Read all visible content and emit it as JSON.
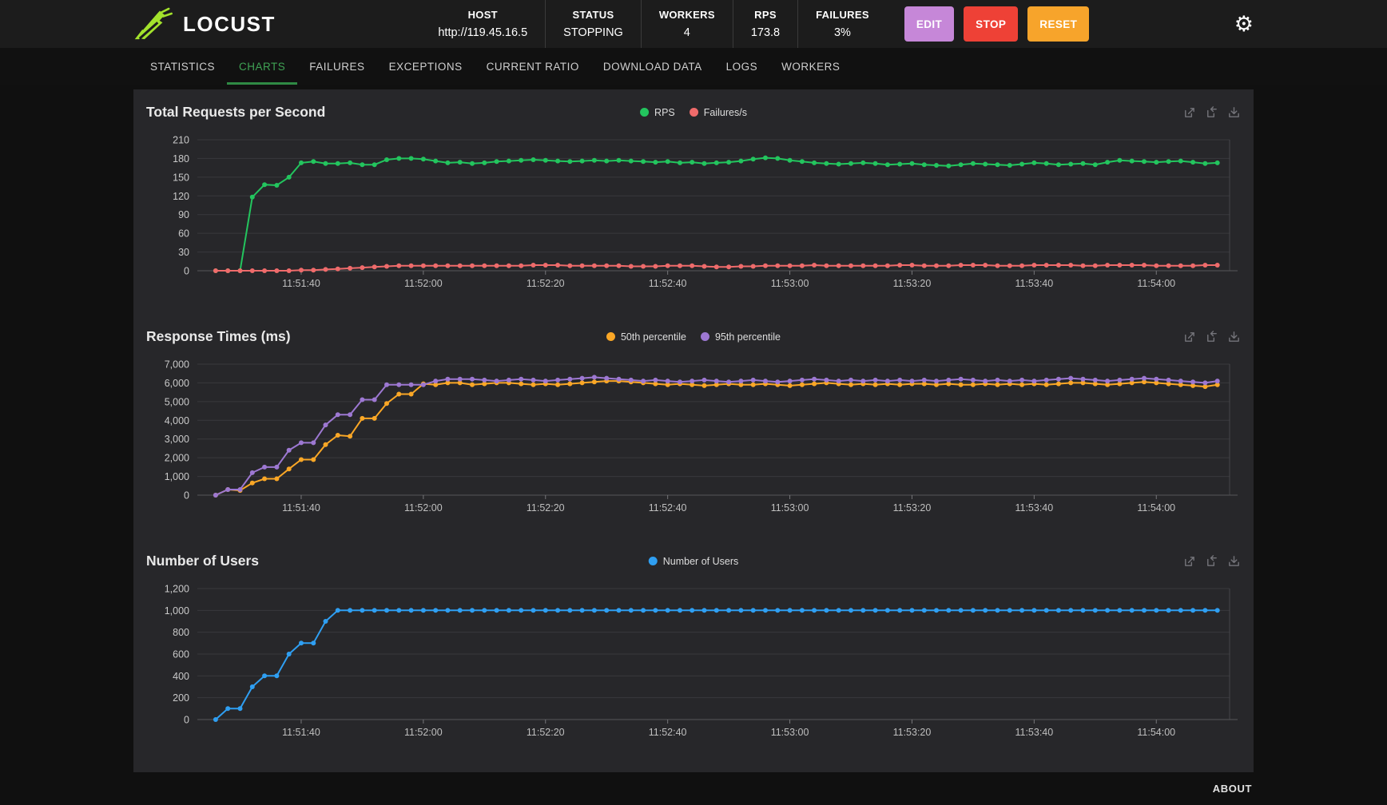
{
  "app": {
    "logo_text": "LOCUST"
  },
  "colors": {
    "logo_green": "#a3e22c",
    "tab_active_green": "#3fa254",
    "rps_green": "#23c55e",
    "failures_red": "#ef6b6b",
    "p50_orange": "#faa726",
    "p95_purple": "#9d78d2",
    "users_blue": "#2f9ff2",
    "edit_purple": "#c687d8",
    "stop_red": "#ee4136",
    "reset_orange": "#f7a42b",
    "panel_bg": "#27272a",
    "header_bg": "#1c1c1c"
  },
  "icons": {
    "settings": "gear-icon",
    "chart_toolbox": [
      "zoom-select-icon",
      "zoom-reset-icon",
      "download-image-icon"
    ]
  },
  "header": {
    "stats": [
      {
        "label": "HOST",
        "value": "http://119.45.16.5"
      },
      {
        "label": "STATUS",
        "value": "STOPPING"
      },
      {
        "label": "WORKERS",
        "value": "4"
      },
      {
        "label": "RPS",
        "value": "173.8"
      },
      {
        "label": "FAILURES",
        "value": "3%"
      }
    ],
    "buttons": {
      "edit": "EDIT",
      "stop": "STOP",
      "reset": "RESET"
    }
  },
  "tabs": {
    "items": [
      {
        "label": "STATISTICS",
        "active": false
      },
      {
        "label": "CHARTS",
        "active": true
      },
      {
        "label": "FAILURES",
        "active": false
      },
      {
        "label": "EXCEPTIONS",
        "active": false
      },
      {
        "label": "CURRENT RATIO",
        "active": false
      },
      {
        "label": "DOWNLOAD DATA",
        "active": false
      },
      {
        "label": "LOGS",
        "active": false
      },
      {
        "label": "WORKERS",
        "active": false
      }
    ]
  },
  "footer": {
    "about": "ABOUT"
  },
  "chart_data": [
    {
      "type": "line",
      "title": "Total Requests per Second",
      "y_max": 210,
      "y_ticks": [
        0,
        30,
        60,
        90,
        120,
        150,
        180,
        210
      ],
      "y_tick_labels": [
        "0",
        "30",
        "60",
        "90",
        "120",
        "150",
        "180",
        "210"
      ],
      "x_axis": {
        "start": "11:51:23",
        "end": "11:54:12",
        "ticks": [
          "11:51:40",
          "11:52:00",
          "11:52:20",
          "11:52:40",
          "11:53:00",
          "11:53:20",
          "11:53:40",
          "11:54:00"
        ]
      },
      "points_start": "11:51:26",
      "points_interval_s": 2,
      "series": [
        {
          "name": "RPS",
          "color": "#23c55e",
          "values": [
            0,
            0,
            0,
            118,
            138,
            137,
            150,
            173,
            175,
            172,
            172,
            173,
            170,
            170,
            178,
            180,
            180,
            179,
            176,
            173,
            174,
            172,
            173,
            175,
            176,
            177,
            178,
            177,
            176,
            175,
            176,
            177,
            176,
            177,
            176,
            175,
            174,
            175,
            173,
            174,
            172,
            173,
            174,
            176,
            179,
            181,
            180,
            177,
            175,
            173,
            172,
            171,
            172,
            173,
            172,
            170,
            171,
            172,
            170,
            169,
            168,
            170,
            172,
            171,
            170,
            169,
            171,
            173,
            172,
            170,
            171,
            172,
            170,
            174,
            177,
            176,
            175,
            174,
            175,
            176,
            174,
            172,
            173
          ]
        },
        {
          "name": "Failures/s",
          "color": "#ef6b6b",
          "values": [
            0,
            0,
            0,
            0,
            0,
            0,
            0,
            1,
            1,
            2,
            3,
            4,
            5,
            6,
            7,
            8,
            8,
            8,
            8,
            8,
            8,
            8,
            8,
            8,
            8,
            8,
            9,
            9,
            9,
            8,
            8,
            8,
            8,
            8,
            7,
            7,
            7,
            8,
            8,
            8,
            7,
            6,
            6,
            7,
            7,
            8,
            8,
            8,
            8,
            9,
            8,
            8,
            8,
            8,
            8,
            8,
            9,
            9,
            8,
            8,
            8,
            9,
            9,
            9,
            8,
            8,
            8,
            9,
            9,
            9,
            9,
            8,
            8,
            9,
            9,
            9,
            9,
            8,
            8,
            8,
            8,
            9,
            9
          ]
        }
      ]
    },
    {
      "type": "line",
      "title": "Response Times (ms)",
      "y_max": 7000,
      "y_ticks": [
        0,
        1000,
        2000,
        3000,
        4000,
        5000,
        6000,
        7000
      ],
      "y_tick_labels": [
        "0",
        "1,000",
        "2,000",
        "3,000",
        "4,000",
        "5,000",
        "6,000",
        "7,000"
      ],
      "x_axis": {
        "start": "11:51:23",
        "end": "11:54:12",
        "ticks": [
          "11:51:40",
          "11:52:00",
          "11:52:20",
          "11:52:40",
          "11:53:00",
          "11:53:20",
          "11:53:40",
          "11:54:00"
        ]
      },
      "points_start": "11:51:26",
      "points_interval_s": 2,
      "series": [
        {
          "name": "50th percentile",
          "color": "#faa726",
          "values": [
            0,
            300,
            250,
            650,
            875,
            875,
            1400,
            1900,
            1900,
            2700,
            3200,
            3150,
            4100,
            4100,
            4900,
            5400,
            5400,
            5950,
            5900,
            6000,
            6000,
            5900,
            5950,
            6000,
            6000,
            5950,
            5900,
            5950,
            5900,
            5950,
            6000,
            6050,
            6100,
            6100,
            6050,
            6000,
            5950,
            5900,
            5950,
            5900,
            5850,
            5900,
            5950,
            5900,
            5900,
            5950,
            5900,
            5850,
            5900,
            5950,
            6000,
            5950,
            5900,
            5950,
            5900,
            5950,
            5900,
            5950,
            5950,
            5900,
            5950,
            5900,
            5900,
            5950,
            5900,
            5950,
            5900,
            5950,
            5900,
            5950,
            6000,
            6000,
            5950,
            5900,
            5950,
            6000,
            6050,
            6000,
            5950,
            5900,
            5850,
            5800,
            5900
          ]
        },
        {
          "name": "95th percentile",
          "color": "#9d78d2",
          "values": [
            0,
            300,
            300,
            1200,
            1500,
            1500,
            2400,
            2800,
            2800,
            3750,
            4300,
            4300,
            5100,
            5100,
            5900,
            5900,
            5900,
            5900,
            6100,
            6200,
            6200,
            6200,
            6150,
            6100,
            6150,
            6200,
            6150,
            6100,
            6150,
            6200,
            6250,
            6300,
            6250,
            6200,
            6150,
            6100,
            6150,
            6100,
            6050,
            6100,
            6150,
            6100,
            6050,
            6100,
            6150,
            6100,
            6050,
            6100,
            6150,
            6200,
            6150,
            6100,
            6150,
            6100,
            6150,
            6100,
            6150,
            6100,
            6150,
            6100,
            6150,
            6200,
            6150,
            6100,
            6150,
            6100,
            6150,
            6100,
            6150,
            6200,
            6250,
            6200,
            6150,
            6100,
            6150,
            6200,
            6250,
            6200,
            6150,
            6100,
            6050,
            6000,
            6100
          ]
        }
      ]
    },
    {
      "type": "line",
      "title": "Number of Users",
      "y_max": 1200,
      "y_ticks": [
        0,
        200,
        400,
        600,
        800,
        1000,
        1200
      ],
      "y_tick_labels": [
        "0",
        "200",
        "400",
        "600",
        "800",
        "1,000",
        "1,200"
      ],
      "x_axis": {
        "start": "11:51:23",
        "end": "11:54:12",
        "ticks": [
          "11:51:40",
          "11:52:00",
          "11:52:20",
          "11:52:40",
          "11:53:00",
          "11:53:20",
          "11:53:40",
          "11:54:00"
        ]
      },
      "points_start": "11:51:26",
      "points_interval_s": 2,
      "series": [
        {
          "name": "Number of Users",
          "color": "#2f9ff2",
          "values": [
            0,
            100,
            100,
            300,
            400,
            400,
            600,
            700,
            700,
            900,
            1000,
            1000,
            1000,
            1000,
            1000,
            1000,
            1000,
            1000,
            1000,
            1000,
            1000,
            1000,
            1000,
            1000,
            1000,
            1000,
            1000,
            1000,
            1000,
            1000,
            1000,
            1000,
            1000,
            1000,
            1000,
            1000,
            1000,
            1000,
            1000,
            1000,
            1000,
            1000,
            1000,
            1000,
            1000,
            1000,
            1000,
            1000,
            1000,
            1000,
            1000,
            1000,
            1000,
            1000,
            1000,
            1000,
            1000,
            1000,
            1000,
            1000,
            1000,
            1000,
            1000,
            1000,
            1000,
            1000,
            1000,
            1000,
            1000,
            1000,
            1000,
            1000,
            1000,
            1000,
            1000,
            1000,
            1000,
            1000,
            1000,
            1000,
            1000,
            1000,
            1000
          ]
        }
      ]
    }
  ]
}
